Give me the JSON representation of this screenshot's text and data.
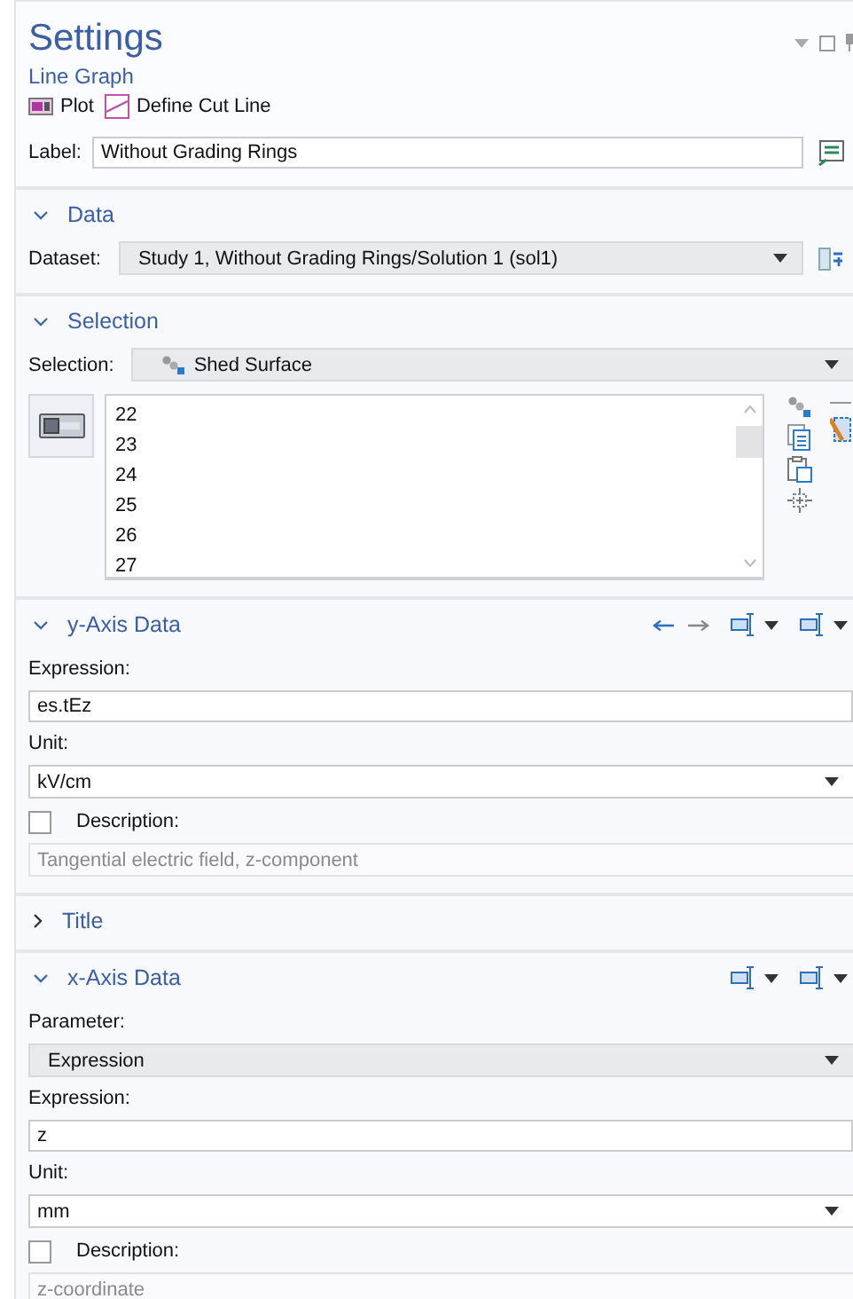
{
  "header": {
    "title": "Settings",
    "subtitle": "Line Graph",
    "toolbar": [
      {
        "kind": "plot",
        "label": "Plot"
      },
      {
        "kind": "cutline",
        "label": "Define Cut Line"
      }
    ]
  },
  "label_row": {
    "label": "Label:",
    "value": "Without Grading Rings"
  },
  "sections": [
    {
      "title": "Data",
      "expanded": true,
      "rows": [
        {
          "kind": "inline-select",
          "label": "Dataset:",
          "value": "Study 1, Without Grading Rings/Solution 1 (sol1)"
        }
      ]
    },
    {
      "title": "Selection",
      "expanded": true,
      "rows": [
        {
          "kind": "selection",
          "label": "Selection:",
          "value": "Shed Surface",
          "items": [
            "22",
            "23",
            "24",
            "25",
            "26",
            "27"
          ]
        }
      ]
    },
    {
      "title": "y-Axis Data",
      "expanded": true,
      "tools": [
        {
          "kind": "arrow-left"
        },
        {
          "kind": "arrow-right"
        },
        {
          "kind": "split"
        },
        {
          "kind": "split"
        }
      ],
      "rows": [
        {
          "kind": "caption",
          "label": "Expression:"
        },
        {
          "kind": "input",
          "value": "es.tEz"
        },
        {
          "kind": "caption",
          "label": "Unit:"
        },
        {
          "kind": "select",
          "value": "kV/cm"
        },
        {
          "kind": "checkbox",
          "label": "Description:",
          "checked": false
        },
        {
          "kind": "readonly",
          "value": "Tangential electric field, z-component",
          "disabled": true
        }
      ]
    },
    {
      "title": "Title",
      "expanded": false
    },
    {
      "title": "x-Axis Data",
      "expanded": true,
      "tools": [
        {
          "kind": "split"
        },
        {
          "kind": "split"
        }
      ],
      "rows": [
        {
          "kind": "caption",
          "label": "Parameter:"
        },
        {
          "kind": "combo",
          "value": "Expression"
        },
        {
          "kind": "caption",
          "label": "Expression:"
        },
        {
          "kind": "input",
          "value": "z"
        },
        {
          "kind": "caption",
          "label": "Unit:"
        },
        {
          "kind": "select",
          "value": "mm"
        },
        {
          "kind": "checkbox",
          "label": "Description:",
          "checked": false
        },
        {
          "kind": "readonly",
          "value": "z-coordinate",
          "disabled": true
        }
      ]
    }
  ]
}
